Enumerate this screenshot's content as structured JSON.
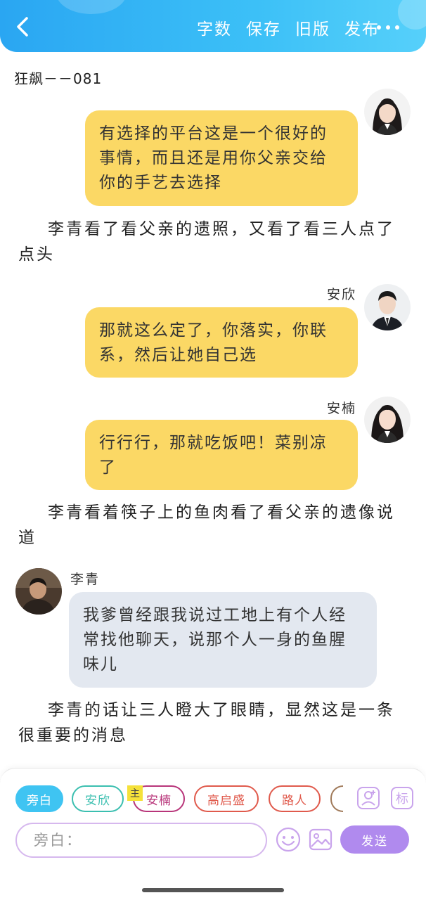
{
  "header": {
    "back_icon": "chevron-left-icon",
    "actions": [
      "字数",
      "保存",
      "旧版",
      "发布"
    ],
    "more_icon": "more-horizontal-icon",
    "colors": {
      "gradient_start": "#2aa6f2",
      "gradient_end": "#56d0fa"
    }
  },
  "book": {
    "title": "狂飙－－081"
  },
  "chat": {
    "msg1": {
      "text": "有选择的平台这是一个很好的事情，而且还是用你父亲交给你的手艺去选择"
    },
    "narr1": "李青看了看父亲的遗照，又看了看三人点了点头",
    "msg2": {
      "speaker": "安欣",
      "text": "那就这么定了，你落实，你联系，然后让她自己选"
    },
    "msg3": {
      "speaker": "安楠",
      "text": "行行行，那就吃饭吧！菜别凉了"
    },
    "narr2": "李青看着筷子上的鱼肉看了看父亲的遗像说道",
    "msg4": {
      "speaker": "李青",
      "text": "我爹曾经跟我说过工地上有个人经常找他聊天，说那个人一身的鱼腥味儿"
    },
    "narr3": "李青的话让三人瞪大了眼睛，显然这是一条很重要的消息",
    "colors": {
      "yellow_bubble": "#fbd865",
      "grey_bubble": "#e3e8f0"
    }
  },
  "toolbar": {
    "chips": [
      {
        "label": "旁白",
        "color": "#3fc4f2",
        "active": true
      },
      {
        "label": "安欣",
        "color": "#3bbfb0",
        "active": false
      },
      {
        "label": "安楠",
        "color": "#b8357a",
        "active": false
      },
      {
        "label": "高启盛",
        "color": "#e05a4c",
        "active": false
      },
      {
        "label": "路人",
        "color": "#e05a4c",
        "active": false
      }
    ],
    "main_tag": "主",
    "add_character_icon": "person-add-icon",
    "tag_icon_label": "标",
    "input_placeholder": "旁白：",
    "emoji_icon": "emoji-icon",
    "image_icon": "image-icon",
    "send_label": "发送",
    "colors": {
      "send": "#b08aee",
      "input_border": "#d6b8ee"
    }
  }
}
